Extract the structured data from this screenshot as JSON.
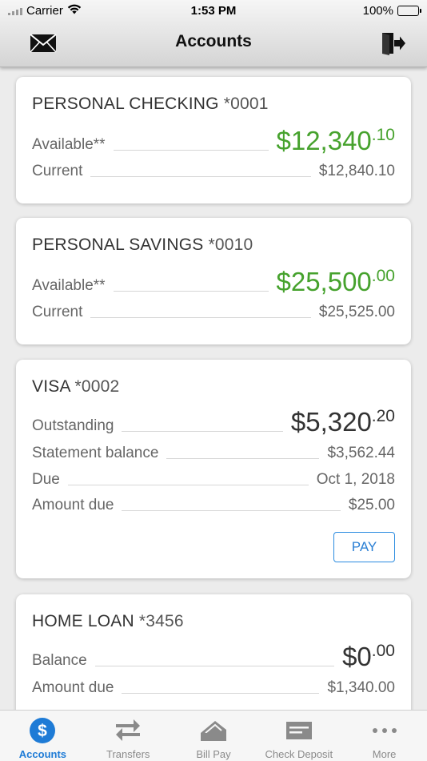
{
  "status_bar": {
    "carrier": "Carrier",
    "time": "1:53 PM",
    "battery": "100%"
  },
  "nav": {
    "title": "Accounts",
    "left_icon": "mail-icon",
    "right_icon": "logout-icon"
  },
  "accounts": [
    {
      "name": "PERSONAL CHECKING",
      "number": "*0001",
      "rows": [
        {
          "label": "Available**",
          "dollars": "$12,340",
          "cents": ".10",
          "style": "green-large"
        },
        {
          "label": "Current",
          "value": "$12,840.10"
        }
      ]
    },
    {
      "name": "PERSONAL SAVINGS",
      "number": "*0010",
      "rows": [
        {
          "label": "Available**",
          "dollars": "$25,500",
          "cents": ".00",
          "style": "green-large"
        },
        {
          "label": "Current",
          "value": "$25,525.00"
        }
      ]
    },
    {
      "name": "VISA",
      "number": "*0002",
      "rows": [
        {
          "label": "Outstanding",
          "dollars": "$5,320",
          "cents": ".20",
          "style": "dark-large"
        },
        {
          "label": "Statement balance",
          "value": "$3,562.44"
        },
        {
          "label": "Due",
          "value": "Oct 1, 2018"
        },
        {
          "label": "Amount due",
          "value": "$25.00"
        }
      ],
      "action_label": "PAY"
    },
    {
      "name": "HOME LOAN",
      "number": "*3456",
      "rows": [
        {
          "label": "Balance",
          "dollars": "$0",
          "cents": ".00",
          "style": "dark-large"
        },
        {
          "label": "Amount due",
          "value": "$1,340.00"
        }
      ]
    }
  ],
  "tabs": [
    {
      "label": "Accounts",
      "icon": "dollar-circle-icon",
      "active": true
    },
    {
      "label": "Transfers",
      "icon": "transfer-arrows-icon"
    },
    {
      "label": "Bill Pay",
      "icon": "bill-pay-icon"
    },
    {
      "label": "Check Deposit",
      "icon": "check-icon"
    },
    {
      "label": "More",
      "icon": "more-dots-icon"
    }
  ],
  "colors": {
    "accent": "#1e7bd6",
    "positive": "#46a22d"
  }
}
